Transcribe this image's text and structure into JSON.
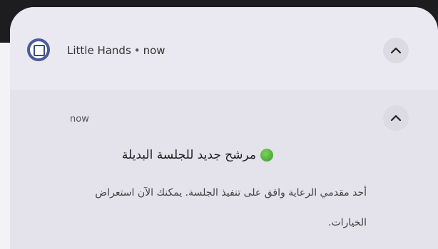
{
  "notification": {
    "app_name": "Little Hands",
    "separator": "•",
    "header_time": "now",
    "time": "now",
    "title": "مرشح جديد للجلسة البديلة",
    "message": "أحد مقدمي الرعاية وافق على تنفيذ الجلسة. يمكنك الآن استعراض الخيارات.",
    "icons": {
      "app": "app-square-icon",
      "collapse": "chevron-up-icon",
      "status": "green-circle-icon"
    },
    "colors": {
      "card": "#e9e7ef",
      "accent": "#4a5a9a",
      "status_dot": "#4caf32"
    }
  }
}
